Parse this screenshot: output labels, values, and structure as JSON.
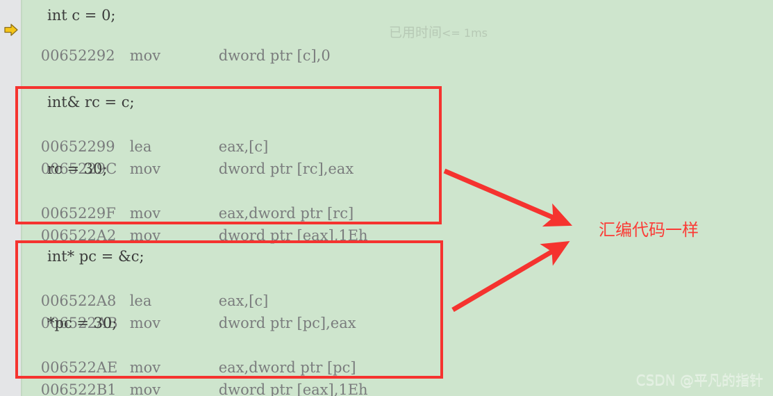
{
  "theme": {
    "code_background": "#cee5cd",
    "gutter_background": "#e4e5e7",
    "address_text_color": "#7a7c7d",
    "source_text_color": "#3b3b3b",
    "highlight_box_color": "#f5332f",
    "annotation_color": "#fb3b36",
    "elapsed_color": "#b7c9b5",
    "exec_arrow_color": "#f5c518"
  },
  "gutter": {
    "exec_pointer_icon": "execution-pointer-arrow-icon"
  },
  "disassembly": {
    "preamble": [
      {
        "kind": "source",
        "text": "int c = 0;"
      },
      {
        "kind": "asm",
        "address": "00652292",
        "mnemonic": "mov",
        "operands": "dword ptr [c],0",
        "current": true,
        "elapsed_label": "已用时间",
        "elapsed_value": "<= 1ms"
      }
    ],
    "blocks": [
      {
        "id": "reference-block",
        "lines": [
          {
            "kind": "source",
            "text": "int& rc = c;"
          },
          {
            "kind": "asm",
            "address": "00652299",
            "mnemonic": "lea",
            "operands": "eax,[c]"
          },
          {
            "kind": "asm",
            "address": "0065229C",
            "mnemonic": "mov",
            "operands": "dword ptr [rc],eax"
          },
          {
            "kind": "source",
            "text": "rc = 30;"
          },
          {
            "kind": "asm",
            "address": "0065229F",
            "mnemonic": "mov",
            "operands": "eax,dword ptr [rc]"
          },
          {
            "kind": "asm",
            "address": "006522A2",
            "mnemonic": "mov",
            "operands": "dword ptr [eax],1Eh"
          }
        ]
      },
      {
        "id": "pointer-block",
        "lines": [
          {
            "kind": "source",
            "text": "int* pc = &c;"
          },
          {
            "kind": "asm",
            "address": "006522A8",
            "mnemonic": "lea",
            "operands": "eax,[c]"
          },
          {
            "kind": "asm",
            "address": "006522AB",
            "mnemonic": "mov",
            "operands": "dword ptr [pc],eax"
          },
          {
            "kind": "source",
            "text": "*pc = 30;"
          },
          {
            "kind": "asm",
            "address": "006522AE",
            "mnemonic": "mov",
            "operands": "eax,dword ptr [pc]"
          },
          {
            "kind": "asm",
            "address": "006522B1",
            "mnemonic": "mov",
            "operands": "dword ptr [eax],1Eh"
          }
        ]
      }
    ]
  },
  "annotation": {
    "text": "汇编代码一样"
  },
  "watermark": {
    "text": "CSDN @平凡的指针"
  }
}
